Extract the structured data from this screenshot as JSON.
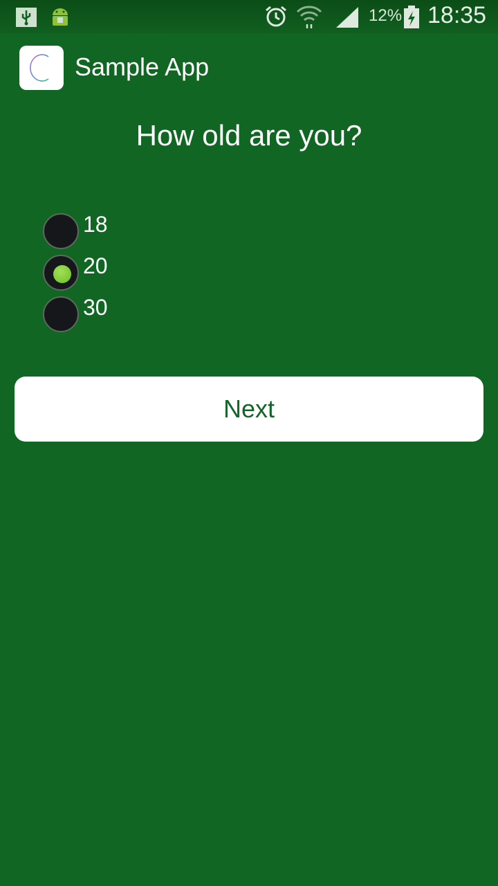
{
  "status_bar": {
    "battery_percent": "12%",
    "time": "18:35",
    "icons": [
      "usb-icon",
      "android-debug-icon",
      "alarm-icon",
      "wifi-icon",
      "cell-signal-icon",
      "battery-charging-icon"
    ]
  },
  "app": {
    "title": "Sample App"
  },
  "question": "How old are you?",
  "options": [
    {
      "label": "18",
      "selected": false
    },
    {
      "label": "20",
      "selected": true
    },
    {
      "label": "30",
      "selected": false
    }
  ],
  "next_button": {
    "label": "Next"
  },
  "colors": {
    "background": "#126623",
    "radio_selected": "#7ccc2e",
    "button_text": "#14652a"
  }
}
